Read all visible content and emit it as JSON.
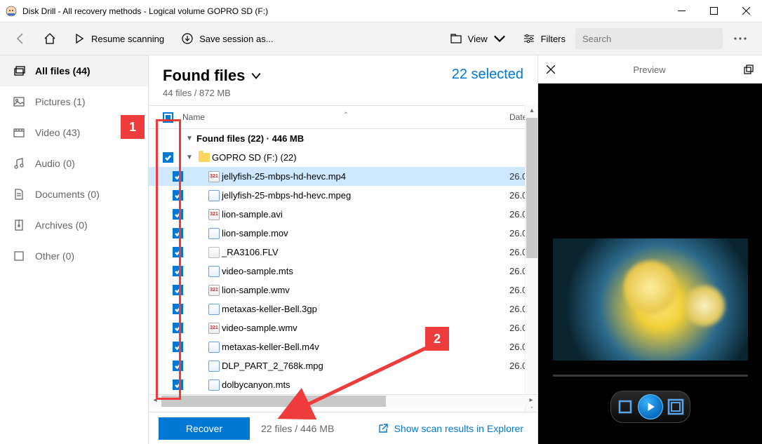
{
  "window": {
    "title": "Disk Drill - All recovery methods - Logical volume GOPRO SD (F:)"
  },
  "toolbar": {
    "resume": "Resume scanning",
    "save_session": "Save session as...",
    "view": "View",
    "filters": "Filters",
    "search_placeholder": "Search"
  },
  "sidebar": {
    "items": [
      {
        "label": "All files (44)"
      },
      {
        "label": "Pictures (1)"
      },
      {
        "label": "Video (43)"
      },
      {
        "label": "Audio (0)"
      },
      {
        "label": "Documents (0)"
      },
      {
        "label": "Archives (0)"
      },
      {
        "label": "Other (0)"
      }
    ]
  },
  "heading": {
    "title": "Found files",
    "sub": "44 files / 872 MB",
    "selected": "22 selected"
  },
  "columns": {
    "name": "Name",
    "date": "Date"
  },
  "groups": {
    "found": "Found files (22) · 446 MB",
    "folder": "GOPRO SD (F:) (22)"
  },
  "files": [
    {
      "name": "jellyfish-25-mbps-hd-hevc.mp4",
      "date": "26.0",
      "icon": "321",
      "selected": true
    },
    {
      "name": "jellyfish-25-mbps-hd-hevc.mpeg",
      "date": "26.0",
      "icon": "mpeg"
    },
    {
      "name": "lion-sample.avi",
      "date": "26.0",
      "icon": "321"
    },
    {
      "name": "lion-sample.mov",
      "date": "26.0",
      "icon": "mpeg"
    },
    {
      "name": "_RA3106.FLV",
      "date": "26.0",
      "icon": "generic"
    },
    {
      "name": "video-sample.mts",
      "date": "26.0",
      "icon": "mpeg"
    },
    {
      "name": "lion-sample.wmv",
      "date": "26.0",
      "icon": "321"
    },
    {
      "name": "metaxas-keller-Bell.3gp",
      "date": "26.0",
      "icon": "mpeg"
    },
    {
      "name": "video-sample.wmv",
      "date": "26.0",
      "icon": "321"
    },
    {
      "name": "metaxas-keller-Bell.m4v",
      "date": "26.0",
      "icon": "mpeg"
    },
    {
      "name": "DLP_PART_2_768k.mpg",
      "date": "26.0",
      "icon": "mpeg"
    },
    {
      "name": "dolbycanyon.mts",
      "date": "",
      "icon": "mpeg"
    }
  ],
  "footer": {
    "recover": "Recover",
    "info": "22 files / 446 MB",
    "explorer": "Show scan results in Explorer"
  },
  "preview": {
    "title": "Preview"
  },
  "annotations": {
    "badge1": "1",
    "badge2": "2"
  }
}
